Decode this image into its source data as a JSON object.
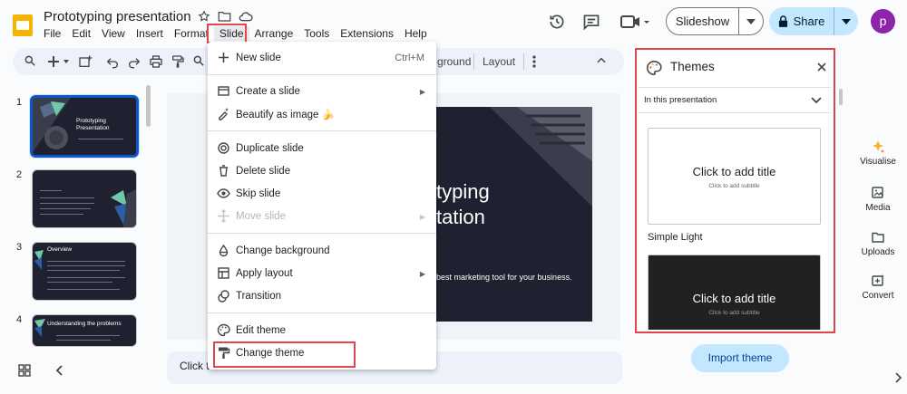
{
  "doc": {
    "title": "Prototyping presentation"
  },
  "menubar": {
    "items": [
      "File",
      "Edit",
      "View",
      "Insert",
      "Format",
      "Slide",
      "Arrange",
      "Tools",
      "Extensions",
      "Help"
    ],
    "active": "Slide"
  },
  "header": {
    "slideshow_label": "Slideshow",
    "share_label": "Share",
    "avatar_initial": "p"
  },
  "toolbar": {
    "background_partial": "ground",
    "layout_label": "Layout"
  },
  "filmstrip": {
    "slides": [
      {
        "number": "1",
        "title": "Prototyping Presentation",
        "selected": true
      },
      {
        "number": "2",
        "title": "",
        "selected": false
      },
      {
        "number": "3",
        "title": "Overview",
        "selected": false
      },
      {
        "number": "4",
        "title": "Understanding the problems",
        "selected": false
      }
    ]
  },
  "canvas": {
    "title": "typing\ntation",
    "subtitle": "best marketing tool for your business."
  },
  "notes": {
    "placeholder_partial": "Click t"
  },
  "slide_menu": {
    "items": [
      {
        "label": "New slide",
        "shortcut": "Ctrl+M",
        "icon": "plus-icon"
      },
      {
        "label": "Create a slide",
        "submenu": true,
        "icon": "create-slide-icon"
      },
      {
        "label": "Beautify as image 🍌",
        "icon": "sparkle-pencil-icon"
      },
      {
        "label": "Duplicate slide",
        "icon": "duplicate-icon"
      },
      {
        "label": "Delete slide",
        "icon": "trash-icon"
      },
      {
        "label": "Skip slide",
        "icon": "eye-icon"
      },
      {
        "label": "Move slide",
        "submenu": true,
        "disabled": true,
        "icon": "move-icon"
      },
      {
        "label": "Change background",
        "icon": "paint-drop-icon"
      },
      {
        "label": "Apply layout",
        "submenu": true,
        "icon": "layout-icon"
      },
      {
        "label": "Transition",
        "icon": "transition-icon"
      },
      {
        "label": "Edit theme",
        "icon": "palette-icon"
      },
      {
        "label": "Change theme",
        "icon": "paint-roller-icon"
      }
    ]
  },
  "themes_panel": {
    "title": "Themes",
    "filter_label": "In this presentation",
    "cards": [
      {
        "title": "Click to add title",
        "subtitle": "Click to add subtitle",
        "name": "Simple Light",
        "style": "light"
      },
      {
        "title": "Click to add title",
        "subtitle": "Click to add subtitle",
        "name": "",
        "style": "dark"
      }
    ],
    "import_label": "Import theme"
  },
  "side_panel": {
    "items": [
      {
        "label": "Visualise",
        "icon": "sparkle-icon"
      },
      {
        "label": "Media",
        "icon": "media-icon"
      },
      {
        "label": "Uploads",
        "icon": "folder-icon"
      },
      {
        "label": "Convert",
        "icon": "convert-icon"
      }
    ]
  },
  "colors": {
    "accent": "#0b57d0",
    "highlight": "#e0464c",
    "share_bg": "#c2e7ff",
    "slide_bg": "#1f2130"
  }
}
